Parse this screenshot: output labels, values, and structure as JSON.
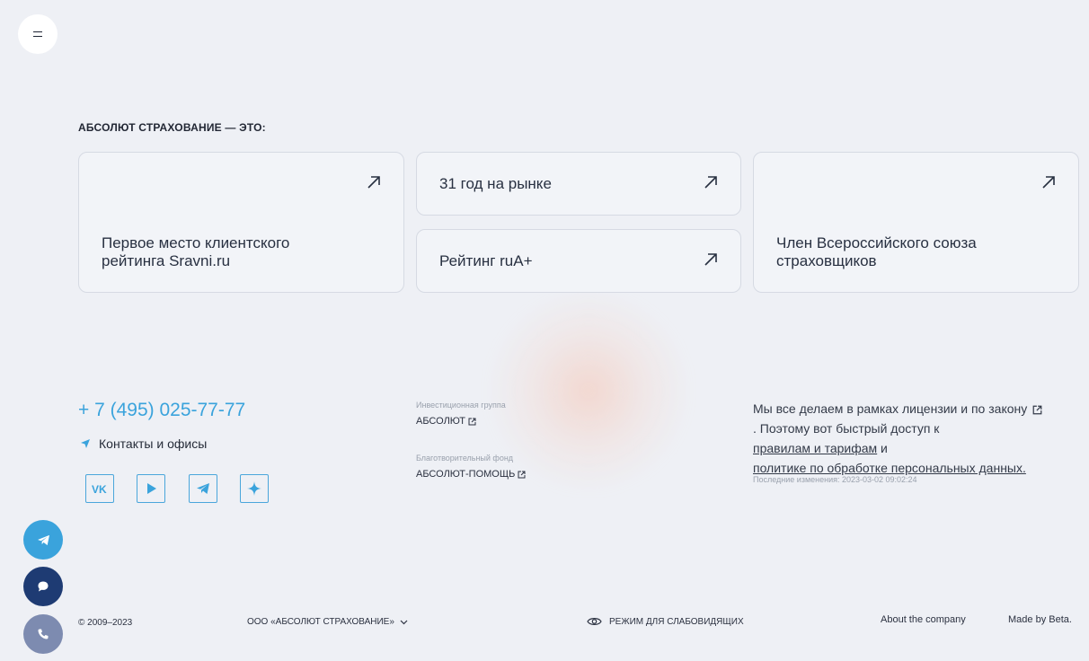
{
  "menu": {
    "icon": "menu-icon"
  },
  "section": {
    "title": "АБСОЛЮТ СТРАХОВАНИЕ — ЭТО:",
    "cards": [
      {
        "label": "Первое место клиентского рейтинга Sravni.ru"
      },
      {
        "label": "31 год на рынке"
      },
      {
        "label": "Рейтинг ruA+"
      },
      {
        "label": "Член Всероссийского союза страховщиков"
      }
    ]
  },
  "contacts": {
    "phone": "+ 7 (495) 025-77-77",
    "offices_label": "Контакты и офисы",
    "social": [
      "vk-icon",
      "youtube-icon",
      "telegram-icon",
      "zen-icon"
    ]
  },
  "partners": [
    {
      "caption": "Инвестиционная группа",
      "link": "АБСОЛЮТ"
    },
    {
      "caption": "Благотворительный фонд",
      "link": "АБСОЛЮТ-ПОМОЩЬ"
    }
  ],
  "license": {
    "text1": "Мы все делаем в рамках лицензии и по закону",
    "text2": ". Поэтому вот быстрый доступ к",
    "link1": "правилам и тарифам",
    "and": " и",
    "link2": "политике по обработке персональных данных.",
    "updated": "Последние изменения: 2023-03-02 09:02:24"
  },
  "footer": {
    "copyright": "© 2009–2023",
    "company": "ООО «АБСОЛЮТ СТРАХОВАНИЕ»",
    "accessibility": "РЕЖИМ ДЛЯ СЛАБОВИДЯЩИХ",
    "about": "About the company",
    "made_by": "Made by Beta."
  },
  "colors": {
    "accent": "#3aa3dc",
    "chat": "#1e3b73",
    "call": "#7d8bb0",
    "background": "#eef0f5"
  }
}
